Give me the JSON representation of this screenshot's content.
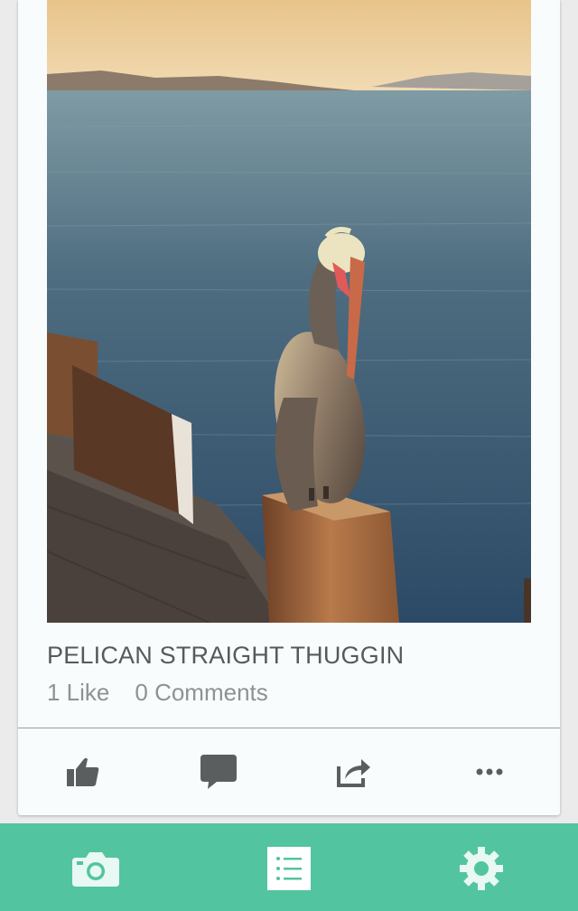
{
  "post": {
    "title": "PELICAN STRAIGHT THUGGIN",
    "likes": "1 Like",
    "comments": "0 Comments"
  },
  "actions": [
    {
      "icon": "thumbs-up-icon"
    },
    {
      "icon": "comment-icon"
    },
    {
      "icon": "share-icon"
    },
    {
      "icon": "more-icon"
    }
  ],
  "tabbar": {
    "background": "#52c4a0",
    "tabs": [
      {
        "icon": "camera-icon"
      },
      {
        "icon": "list-icon",
        "active": true
      },
      {
        "icon": "gear-icon"
      }
    ]
  },
  "colors": {
    "icon": "#5a5e5e",
    "tab_icon": "#ffffff"
  }
}
